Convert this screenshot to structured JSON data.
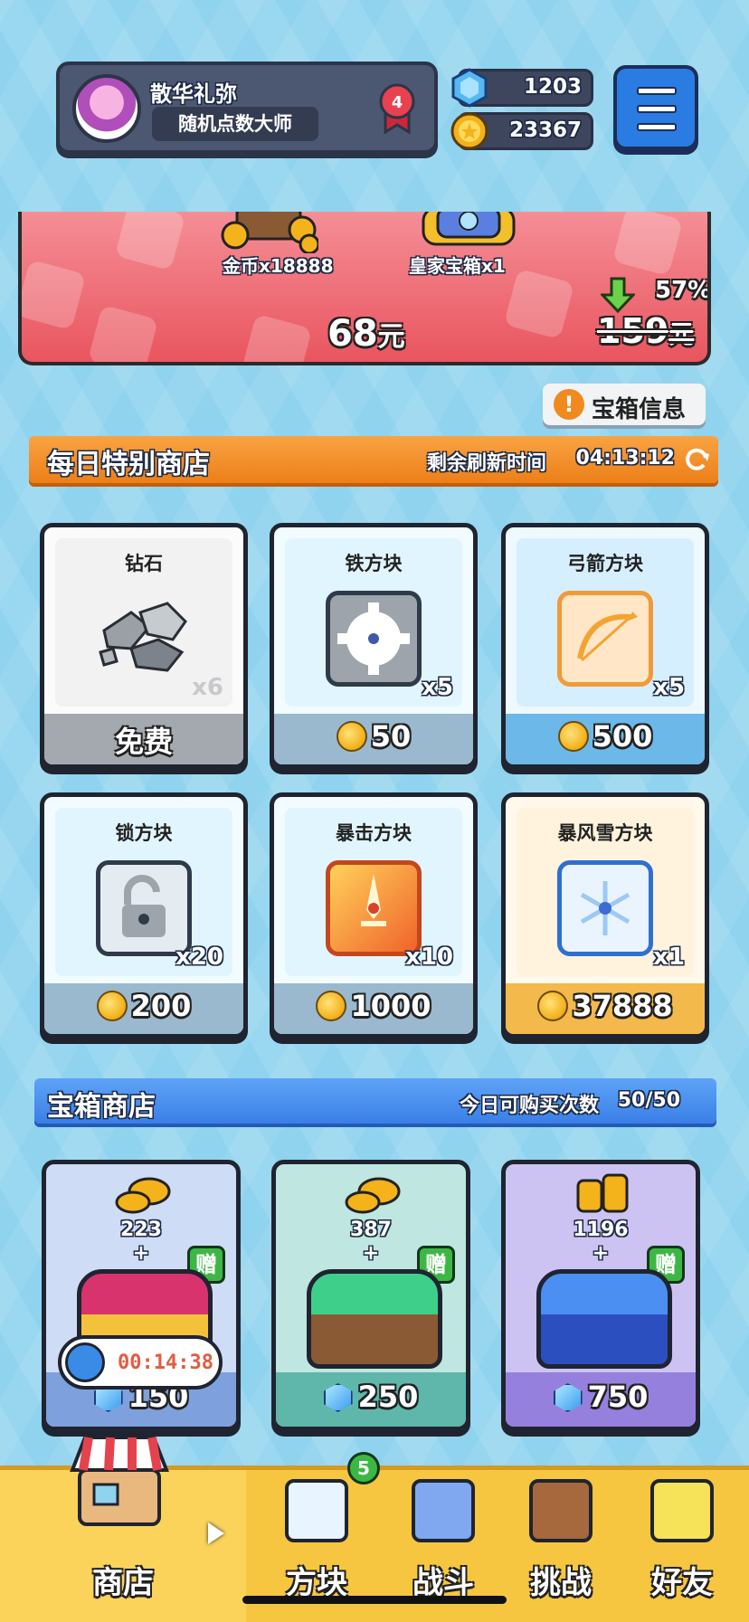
{
  "player": {
    "name": "散华礼弥",
    "title": "随机点数大师",
    "rank": "4"
  },
  "currencies": {
    "gems": "1203",
    "coins": "23367"
  },
  "banner": {
    "item1": "金币x18888",
    "item2": "皇家宝箱x1",
    "price": "68",
    "price_unit": "元",
    "old_price": "159",
    "old_price_unit": "元",
    "discount": "57%"
  },
  "chest_info_button": "宝箱信息",
  "daily_shop": {
    "title": "每日特别商店",
    "refresh_label": "剩余刷新时间",
    "refresh_time": "04:13:12",
    "items": [
      {
        "name": "钻石",
        "qty": "x6",
        "price": "免费"
      },
      {
        "name": "铁方块",
        "qty": "x5",
        "price": "50"
      },
      {
        "name": "弓箭方块",
        "qty": "x5",
        "price": "500"
      },
      {
        "name": "锁方块",
        "qty": "x20",
        "price": "200"
      },
      {
        "name": "暴击方块",
        "qty": "x10",
        "price": "1000"
      },
      {
        "name": "暴风雪方块",
        "qty": "x1",
        "price": "37888"
      }
    ]
  },
  "chest_shop": {
    "title": "宝箱商店",
    "limit_label": "今日可购买次数",
    "limit_value": "50/50",
    "bonus_label": "赠",
    "chests": [
      {
        "coins": "223",
        "price": "150",
        "timer": "00:14:38"
      },
      {
        "coins": "387",
        "price": "250"
      },
      {
        "coins": "1196",
        "price": "750"
      }
    ]
  },
  "nav": {
    "shop": "商店",
    "blocks": "方块",
    "blocks_badge": "5",
    "battle": "战斗",
    "challenge": "挑战",
    "friends": "好友"
  }
}
